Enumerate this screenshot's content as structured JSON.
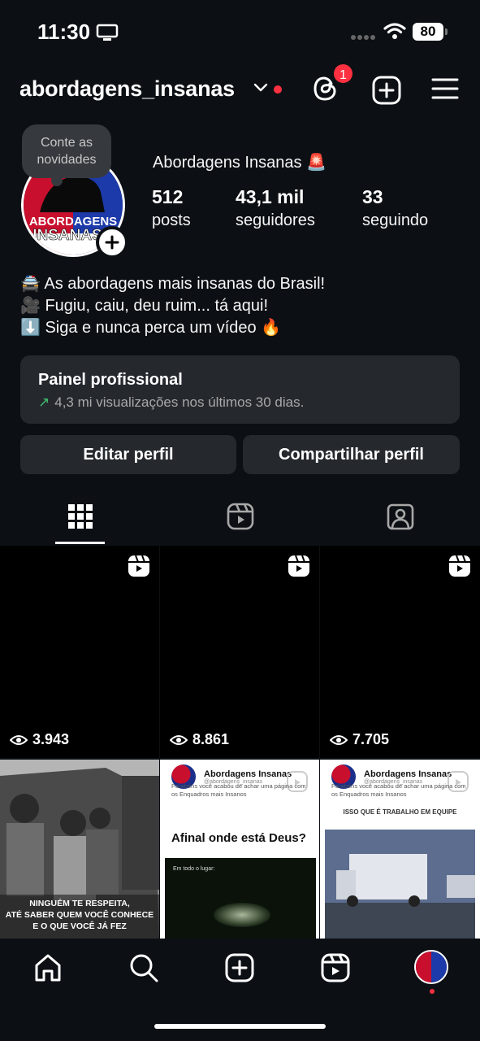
{
  "status_bar": {
    "time": "11:30",
    "battery": "80"
  },
  "header": {
    "username": "abordagens_insanas",
    "threads_badge_count": "1"
  },
  "profile": {
    "note": "Conte as novidades",
    "display_name": "Abordagens Insanas 🚨",
    "avatar_text_line1": "ABORDAGENS",
    "avatar_text_line2": "INSANAS",
    "stats": [
      {
        "value": "512",
        "label": "posts"
      },
      {
        "value": "43,1 mil",
        "label": "seguidores"
      },
      {
        "value": "33",
        "label": "seguindo"
      }
    ],
    "bio": [
      "🚔 As abordagens mais insanas do Brasil!",
      "🎥 Fugiu, caiu, deu ruim... tá aqui!",
      "⬇️ Siga e nunca perca um vídeo 🔥"
    ]
  },
  "pro_panel": {
    "title": "Painel profissional",
    "arrow": "↗",
    "subtitle": "4,3 mi visualizações nos últimos 30 dias."
  },
  "buttons": {
    "edit": "Editar perfil",
    "share": "Compartilhar perfil"
  },
  "grid": {
    "top_row_views": [
      "3.943",
      "8.861",
      "7.705"
    ],
    "post4_caption": [
      "NINGUÉM TE RESPEITA,",
      "ATÉ SABER QUEM VOCÊ CONHECE",
      "E O QUE VOCÊ JÁ FEZ"
    ],
    "post5": {
      "name": "Abordagens Insanas",
      "handle": "@abordagens_insanas",
      "text": "Parabéns você acabou de achar uma página com os Enquadros mais Insanos",
      "title": "Afinal onde está Deus?",
      "video_caption": "Em todo o lugar:"
    },
    "post6": {
      "name": "Abordagens Insanas",
      "handle": "@abordagens_insanas",
      "text": "Parabéns você acabou de achar uma página com os Enquadros mais Insanos",
      "title": "ISSO QUE É TRABALHO EM EQUIPE"
    }
  },
  "colors": {
    "background": "#0c1014",
    "surface": "#25292e",
    "accent_red": "#ff3040",
    "green": "#3fbf6d"
  },
  "icons": [
    "threads-icon",
    "new-post-icon",
    "menu-icon",
    "grid-icon",
    "reels-icon",
    "tagged-icon",
    "home-icon",
    "search-icon",
    "create-icon",
    "reels-nav-icon",
    "eye-icon",
    "reel-badge-icon"
  ]
}
